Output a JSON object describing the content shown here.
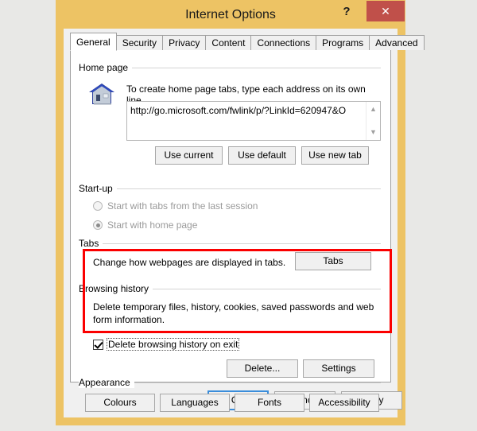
{
  "window": {
    "title": "Internet Options",
    "help_label": "?",
    "close_label": "✕",
    "frame_color": "#edc364",
    "close_color": "#c0504a",
    "desktop_color": "#e8e8e6"
  },
  "tabs": [
    {
      "label": "General",
      "active": true
    },
    {
      "label": "Security",
      "active": false
    },
    {
      "label": "Privacy",
      "active": false
    },
    {
      "label": "Content",
      "active": false
    },
    {
      "label": "Connections",
      "active": false
    },
    {
      "label": "Programs",
      "active": false
    },
    {
      "label": "Advanced",
      "active": false
    }
  ],
  "home_page": {
    "group_title": "Home page",
    "icon": "house-icon",
    "description": "To create home page tabs, type each address on its own line.",
    "url_value": "http://go.microsoft.com/fwlink/p/?LinkId=620947&O",
    "scroll_up": "▲",
    "scroll_down": "▼",
    "buttons": {
      "use_current": "Use current",
      "use_default": "Use default",
      "use_new_tab": "Use new tab"
    }
  },
  "startup": {
    "group_title": "Start-up",
    "options": [
      {
        "label": "Start with tabs from the last session",
        "selected": false,
        "disabled": true
      },
      {
        "label": "Start with home page",
        "selected": true,
        "disabled": true
      }
    ]
  },
  "tabs_section": {
    "group_title": "Tabs",
    "description": "Change how webpages are displayed in tabs.",
    "button_label": "Tabs"
  },
  "browsing_history": {
    "group_title": "Browsing history",
    "description_line1": "Delete temporary files, history, cookies, saved passwords and web",
    "description_line2": "form information.",
    "checkbox_label": "Delete browsing history on exit",
    "checkbox_checked": true,
    "delete_button": "Delete...",
    "settings_button": "Settings",
    "highlight_color": "#fb0000"
  },
  "appearance": {
    "group_title": "Appearance",
    "buttons": {
      "colours": "Colours",
      "languages": "Languages",
      "fonts": "Fonts",
      "accessibility": "Accessibility"
    }
  },
  "footer": {
    "ok": "OK",
    "cancel": "Cancel",
    "apply": "Apply",
    "default_accent": "#3a8ddb"
  }
}
